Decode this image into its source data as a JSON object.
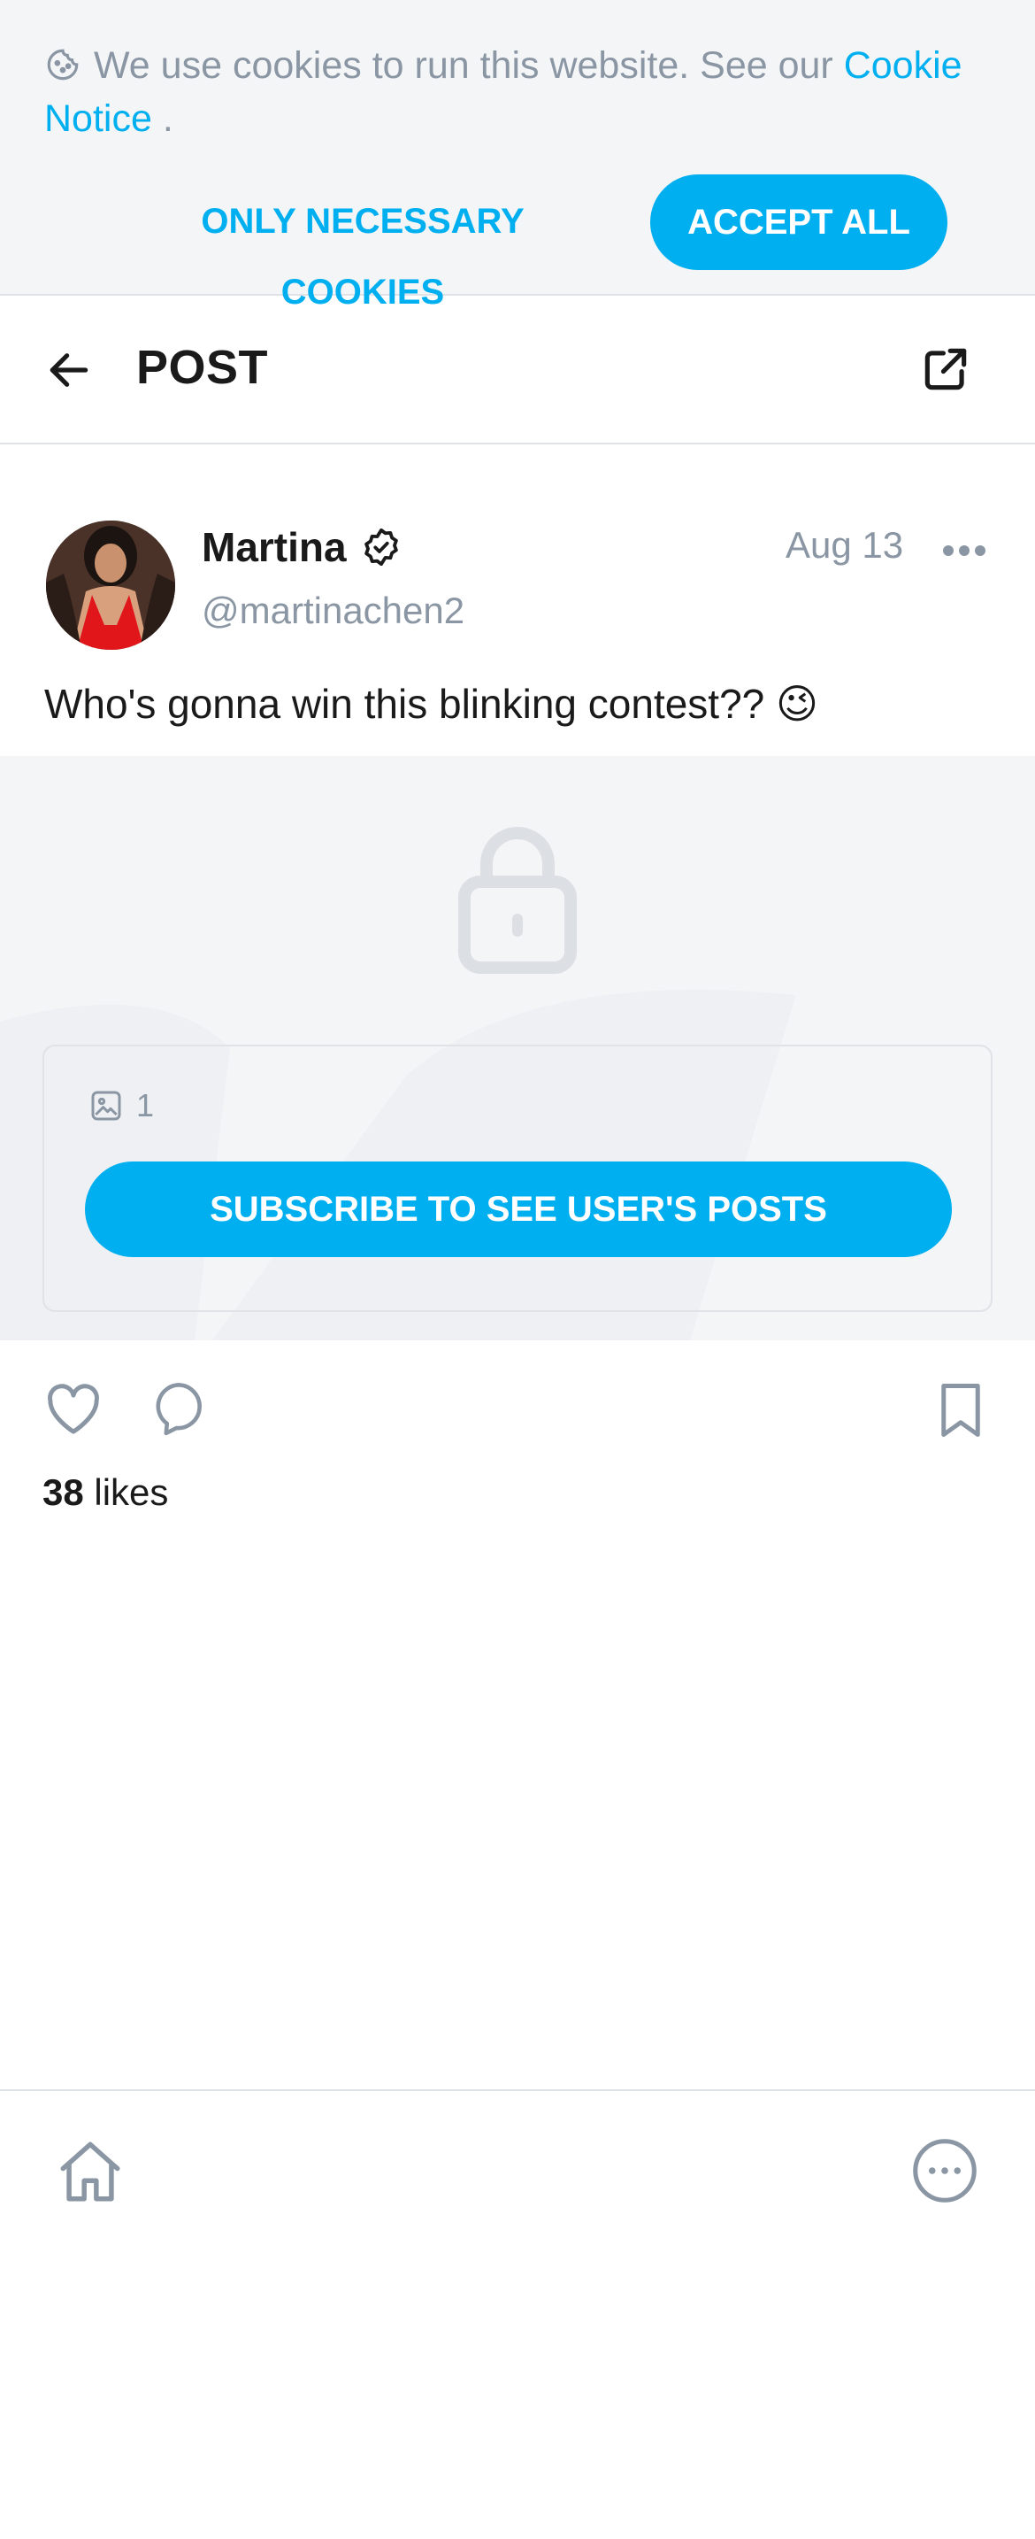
{
  "cookie_banner": {
    "text": "We use cookies to run this website. See our ",
    "link_text": "Cookie Notice",
    "suffix": " .",
    "necessary_label": "ONLY NECESSARY COOKIES",
    "accept_label": "ACCEPT ALL",
    "icon": "cookie-icon"
  },
  "header": {
    "title": "POST",
    "back_icon": "arrow-left-icon",
    "share_icon": "share-icon"
  },
  "post": {
    "author_name": "Martina",
    "handle": "@martinachen2",
    "date": "Aug 13",
    "text": "Who's gonna win this blinking contest?? 😉",
    "verified": true
  },
  "locked_media": {
    "media_count": "1",
    "subscribe_label": "SUBSCRIBE TO SEE USER'S POSTS"
  },
  "actions": {
    "likes_count": "38",
    "likes_label": " likes"
  },
  "colors": {
    "accent": "#00aff0",
    "muted": "#8a96a3",
    "banner_bg": "#f4f5f7",
    "border": "#dfe2e6"
  }
}
